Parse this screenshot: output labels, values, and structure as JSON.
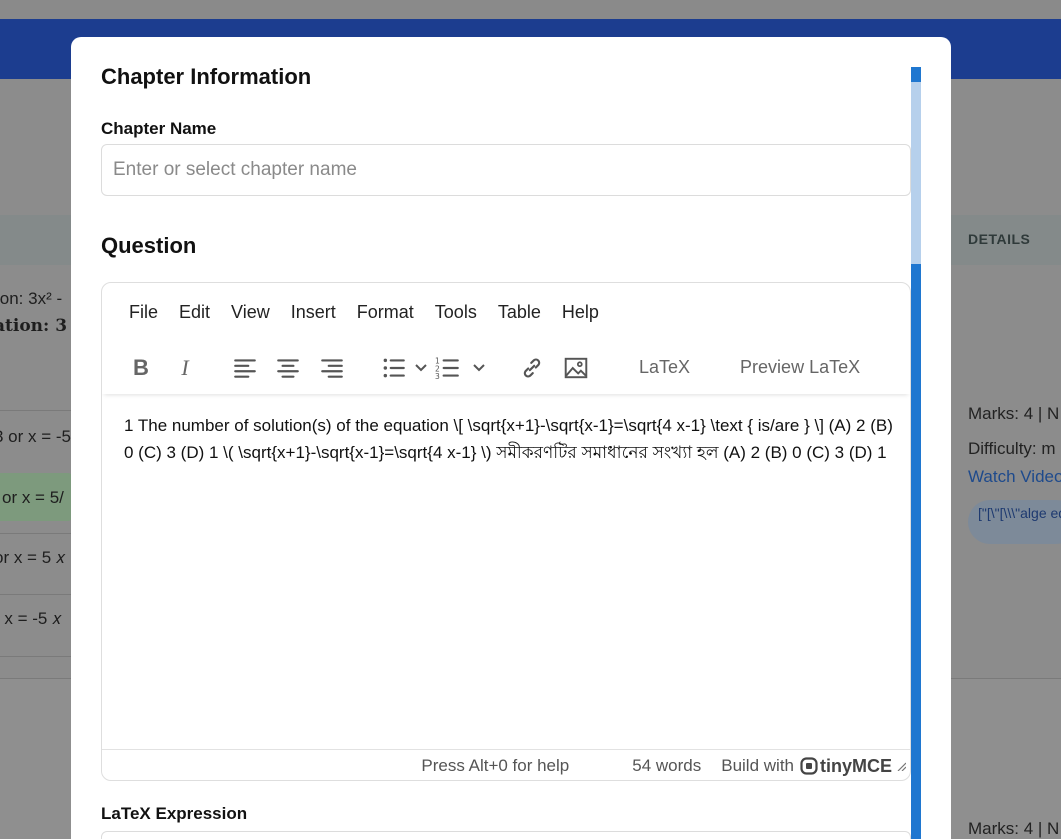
{
  "background": {
    "details_header": "DETAILS",
    "left_fragments": [
      "ion: 3x² -",
      "ation: 3",
      "3 or x = -5",
      "or x = 5/",
      "or x = 5 𝑥",
      "r x = -5 𝑥"
    ],
    "right_fragments": {
      "marks_1": "Marks: 4 | N",
      "difficulty": "Difficulty: m",
      "watch_video": "Watch Video",
      "tag_chip": "[\"[\\\"[\\\\\\\"alge equations\\\\\\",
      "marks_2": "Marks: 4 | N"
    }
  },
  "modal": {
    "title": "Chapter Information",
    "chapter_label": "Chapter Name",
    "chapter_placeholder": "Enter or select chapter name",
    "question_title": "Question",
    "latex_label": "LaTeX Expression"
  },
  "editor": {
    "menu": [
      "File",
      "Edit",
      "View",
      "Insert",
      "Format",
      "Tools",
      "Table",
      "Help"
    ],
    "toolbar": {
      "latex_button": "LaTeX",
      "preview_button": "Preview LaTeX"
    },
    "content": "1 The number of solution(s) of the equation \\[ \\sqrt{x+1}-\\sqrt{x-1}=\\sqrt{4 x-1} \\text { is/are } \\] (A) 2 (B) 0 (C) 3 (D) 1 \\( \\sqrt{x+1}-\\sqrt{x-1}=\\sqrt{4 x-1} \\) সমীকরণটির সমাধানের সংখ্যা হল (A) 2 (B) 0 (C) 3 (D) 1",
    "status": {
      "help": "Press Alt+0 for help",
      "words": "54 words",
      "build": "Build with",
      "brand": "tinyMCE"
    }
  },
  "colors": {
    "scrollbar": "#1f77d0",
    "scroll_thumb": "#b6d0ec",
    "topbar": "#1c3d8f"
  }
}
